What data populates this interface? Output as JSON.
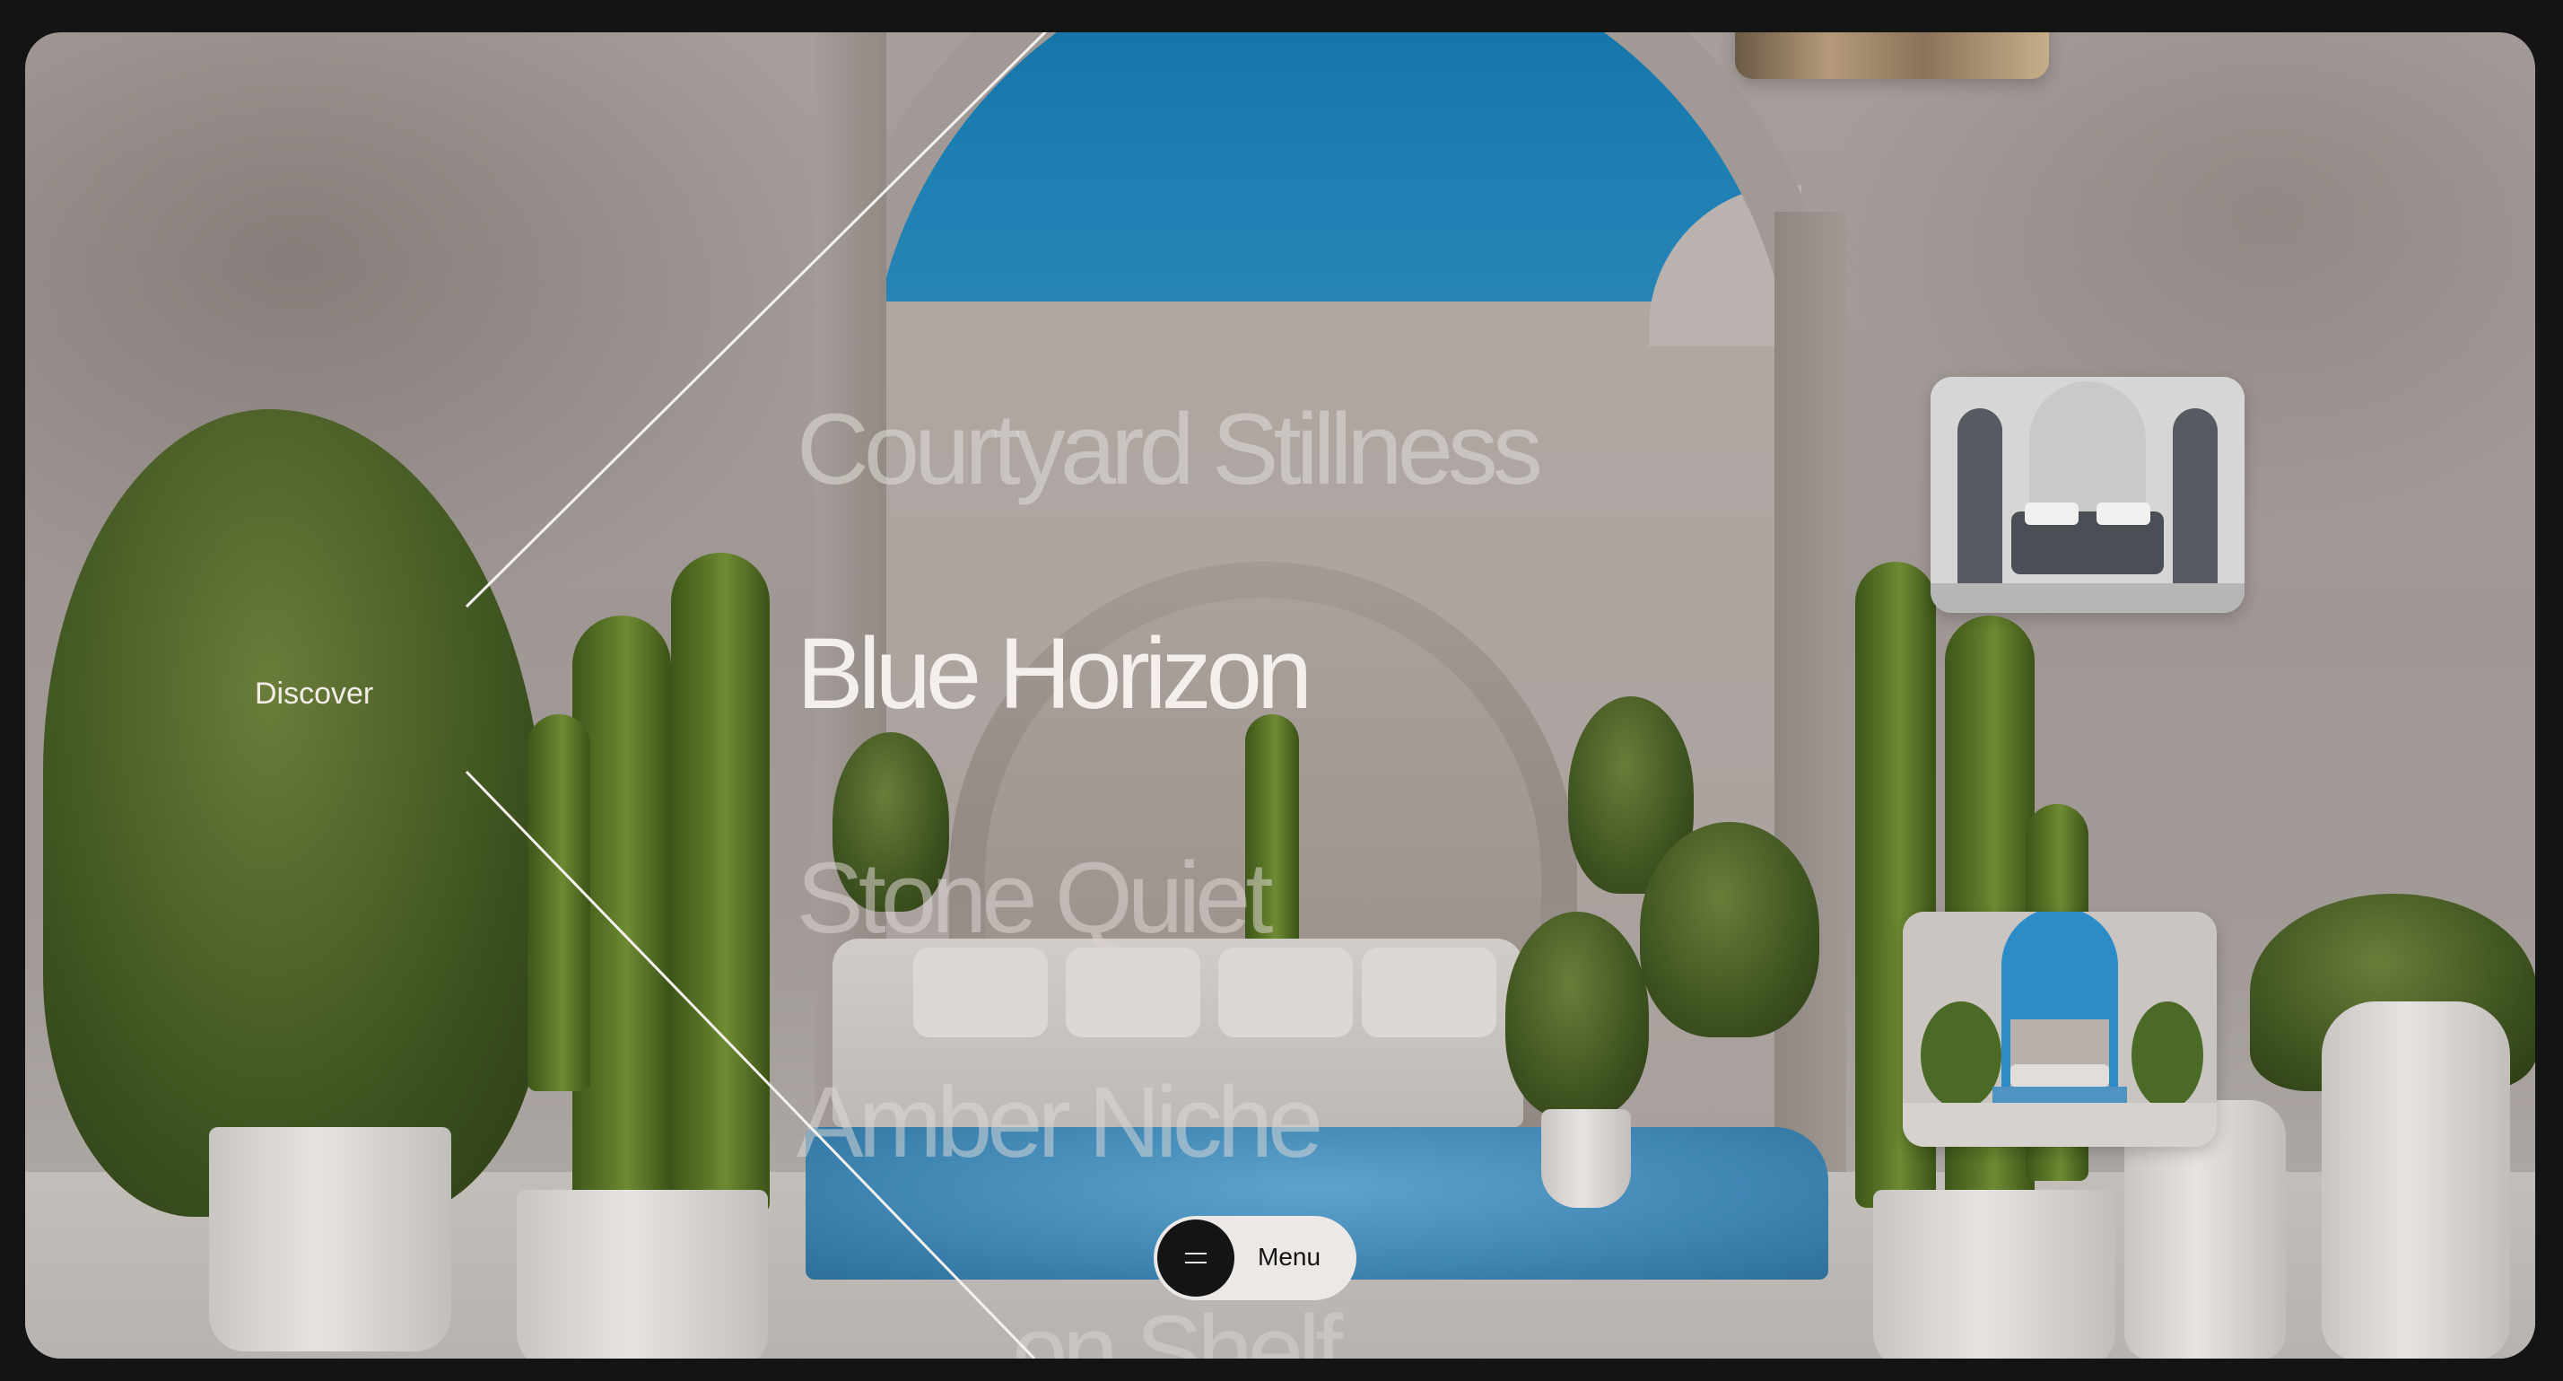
{
  "nav": {
    "discover_label": "Discover",
    "menu_label": "Menu"
  },
  "headings": {
    "items": [
      "Courtyard Stillness",
      "Blue Horizon",
      "Stone Quiet",
      "Amber Niche",
      "on Shelf"
    ]
  },
  "colors": {
    "page_bg": "#141414",
    "heading_active": "#f4efeb",
    "sky": "#106fa3",
    "menu_pill": "#ece8e5"
  },
  "icons": {
    "menu": "hamburger-icon"
  }
}
